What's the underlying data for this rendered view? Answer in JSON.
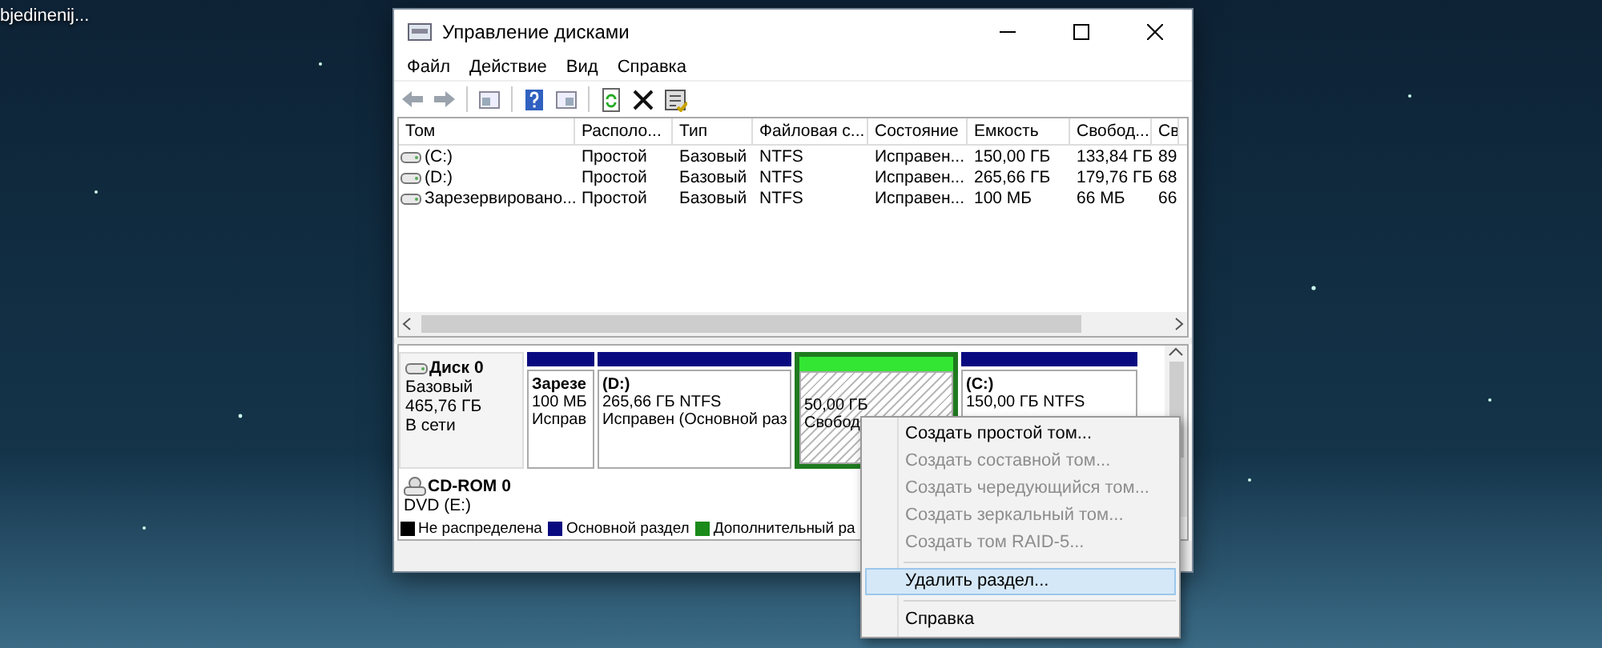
{
  "desktop": {
    "icon_label": "bjedinenij..."
  },
  "window": {
    "title": "Управление дисками"
  },
  "menu": [
    "Файл",
    "Действие",
    "Вид",
    "Справка"
  ],
  "volumes": {
    "columns": [
      "Том",
      "Располо...",
      "Тип",
      "Файловая с...",
      "Состояние",
      "Емкость",
      "Свобод...",
      "Св"
    ],
    "rows": [
      [
        "(C:)",
        "Простой",
        "Базовый",
        "NTFS",
        "Исправен...",
        "150,00 ГБ",
        "133,84 ГБ",
        "89"
      ],
      [
        "(D:)",
        "Простой",
        "Базовый",
        "NTFS",
        "Исправен...",
        "265,66 ГБ",
        "179,76 ГБ",
        "68"
      ],
      [
        "Зарезервировано...",
        "Простой",
        "Базовый",
        "NTFS",
        "Исправен...",
        "100 МБ",
        "66 МБ",
        "66"
      ]
    ]
  },
  "disks": [
    {
      "kind": "disk",
      "name": "Диск 0",
      "lines": [
        "Базовый",
        "465,76 ГБ",
        "В сети"
      ],
      "partitions": [
        {
          "kind": "volume",
          "color": "#0a0a80",
          "title": "Зарезе",
          "lines": [
            "100 МБ",
            "Исправ"
          ],
          "selected": false
        },
        {
          "kind": "volume",
          "color": "#0a0a80",
          "title": "(D:)",
          "lines": [
            "265,66 ГБ NTFS",
            "Исправен (Основной раз"
          ],
          "selected": false
        },
        {
          "kind": "free",
          "color": "#33e633",
          "lines": [
            "50,00 ГБ",
            "Свобод"
          ],
          "selected": true
        },
        {
          "kind": "volume",
          "color": "#0a0a80",
          "title": "(C:)",
          "lines": [
            "150,00 ГБ NTFS"
          ],
          "selected": false
        }
      ]
    },
    {
      "kind": "cdrom",
      "name": "CD-ROM 0",
      "lines": [
        "DVD (E:)"
      ]
    }
  ],
  "legend": [
    {
      "label": "Не распределена",
      "color": "#000000"
    },
    {
      "label": "Основной раздел",
      "color": "#0a0a80"
    },
    {
      "label": "Дополнительный ра",
      "color": "#1a8a1a"
    }
  ],
  "context_menu": [
    {
      "kind": "item",
      "label": "Создать простой том...",
      "disabled": false,
      "selected": false
    },
    {
      "kind": "item",
      "label": "Создать составной том...",
      "disabled": true,
      "selected": false
    },
    {
      "kind": "item",
      "label": "Создать чередующийся том...",
      "disabled": true,
      "selected": false
    },
    {
      "kind": "item",
      "label": "Создать зеркальный том...",
      "disabled": true,
      "selected": false
    },
    {
      "kind": "item",
      "label": "Создать том RAID-5...",
      "disabled": true,
      "selected": false
    },
    {
      "kind": "separator"
    },
    {
      "kind": "item",
      "label": "Удалить раздел...",
      "disabled": false,
      "selected": true
    },
    {
      "kind": "separator"
    },
    {
      "kind": "item",
      "label": "Справка",
      "disabled": false,
      "selected": false
    }
  ]
}
